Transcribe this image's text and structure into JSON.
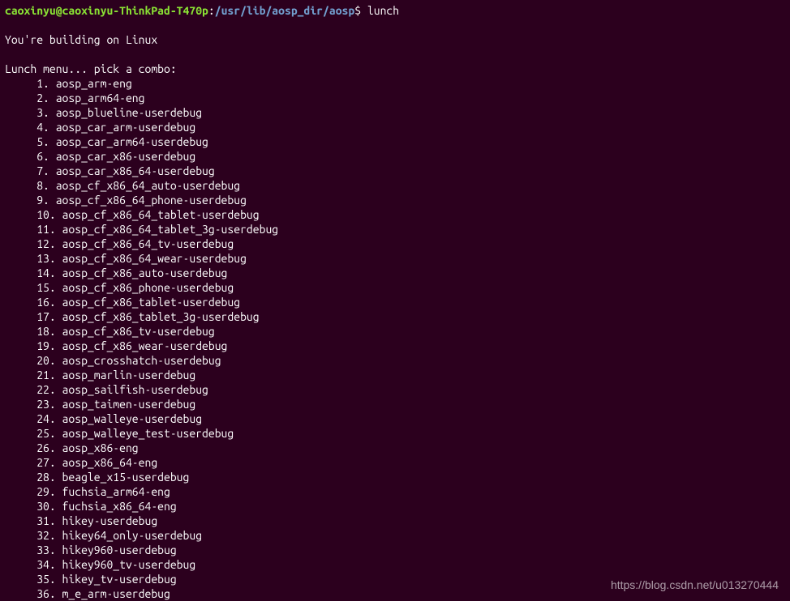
{
  "prompt": {
    "user_host": "caoxinyu@caoxinyu-ThinkPad-T470p",
    "colon": ":",
    "path": "/usr/lib/aosp_dir/aosp",
    "dollar": "$",
    "command": "lunch"
  },
  "output": {
    "build_msg": "You're building on Linux",
    "menu_header": "Lunch menu... pick a combo:"
  },
  "menu_items": [
    "     1. aosp_arm-eng",
    "     2. aosp_arm64-eng",
    "     3. aosp_blueline-userdebug",
    "     4. aosp_car_arm-userdebug",
    "     5. aosp_car_arm64-userdebug",
    "     6. aosp_car_x86-userdebug",
    "     7. aosp_car_x86_64-userdebug",
    "     8. aosp_cf_x86_64_auto-userdebug",
    "     9. aosp_cf_x86_64_phone-userdebug",
    "     10. aosp_cf_x86_64_tablet-userdebug",
    "     11. aosp_cf_x86_64_tablet_3g-userdebug",
    "     12. aosp_cf_x86_64_tv-userdebug",
    "     13. aosp_cf_x86_64_wear-userdebug",
    "     14. aosp_cf_x86_auto-userdebug",
    "     15. aosp_cf_x86_phone-userdebug",
    "     16. aosp_cf_x86_tablet-userdebug",
    "     17. aosp_cf_x86_tablet_3g-userdebug",
    "     18. aosp_cf_x86_tv-userdebug",
    "     19. aosp_cf_x86_wear-userdebug",
    "     20. aosp_crosshatch-userdebug",
    "     21. aosp_marlin-userdebug",
    "     22. aosp_sailfish-userdebug",
    "     23. aosp_taimen-userdebug",
    "     24. aosp_walleye-userdebug",
    "     25. aosp_walleye_test-userdebug",
    "     26. aosp_x86-eng",
    "     27. aosp_x86_64-eng",
    "     28. beagle_x15-userdebug",
    "     29. fuchsia_arm64-eng",
    "     30. fuchsia_x86_64-eng",
    "     31. hikey-userdebug",
    "     32. hikey64_only-userdebug",
    "     33. hikey960-userdebug",
    "     34. hikey960_tv-userdebug",
    "     35. hikey_tv-userdebug",
    "     36. m_e_arm-userdebug"
  ],
  "watermark": "https://blog.csdn.net/u013270444"
}
